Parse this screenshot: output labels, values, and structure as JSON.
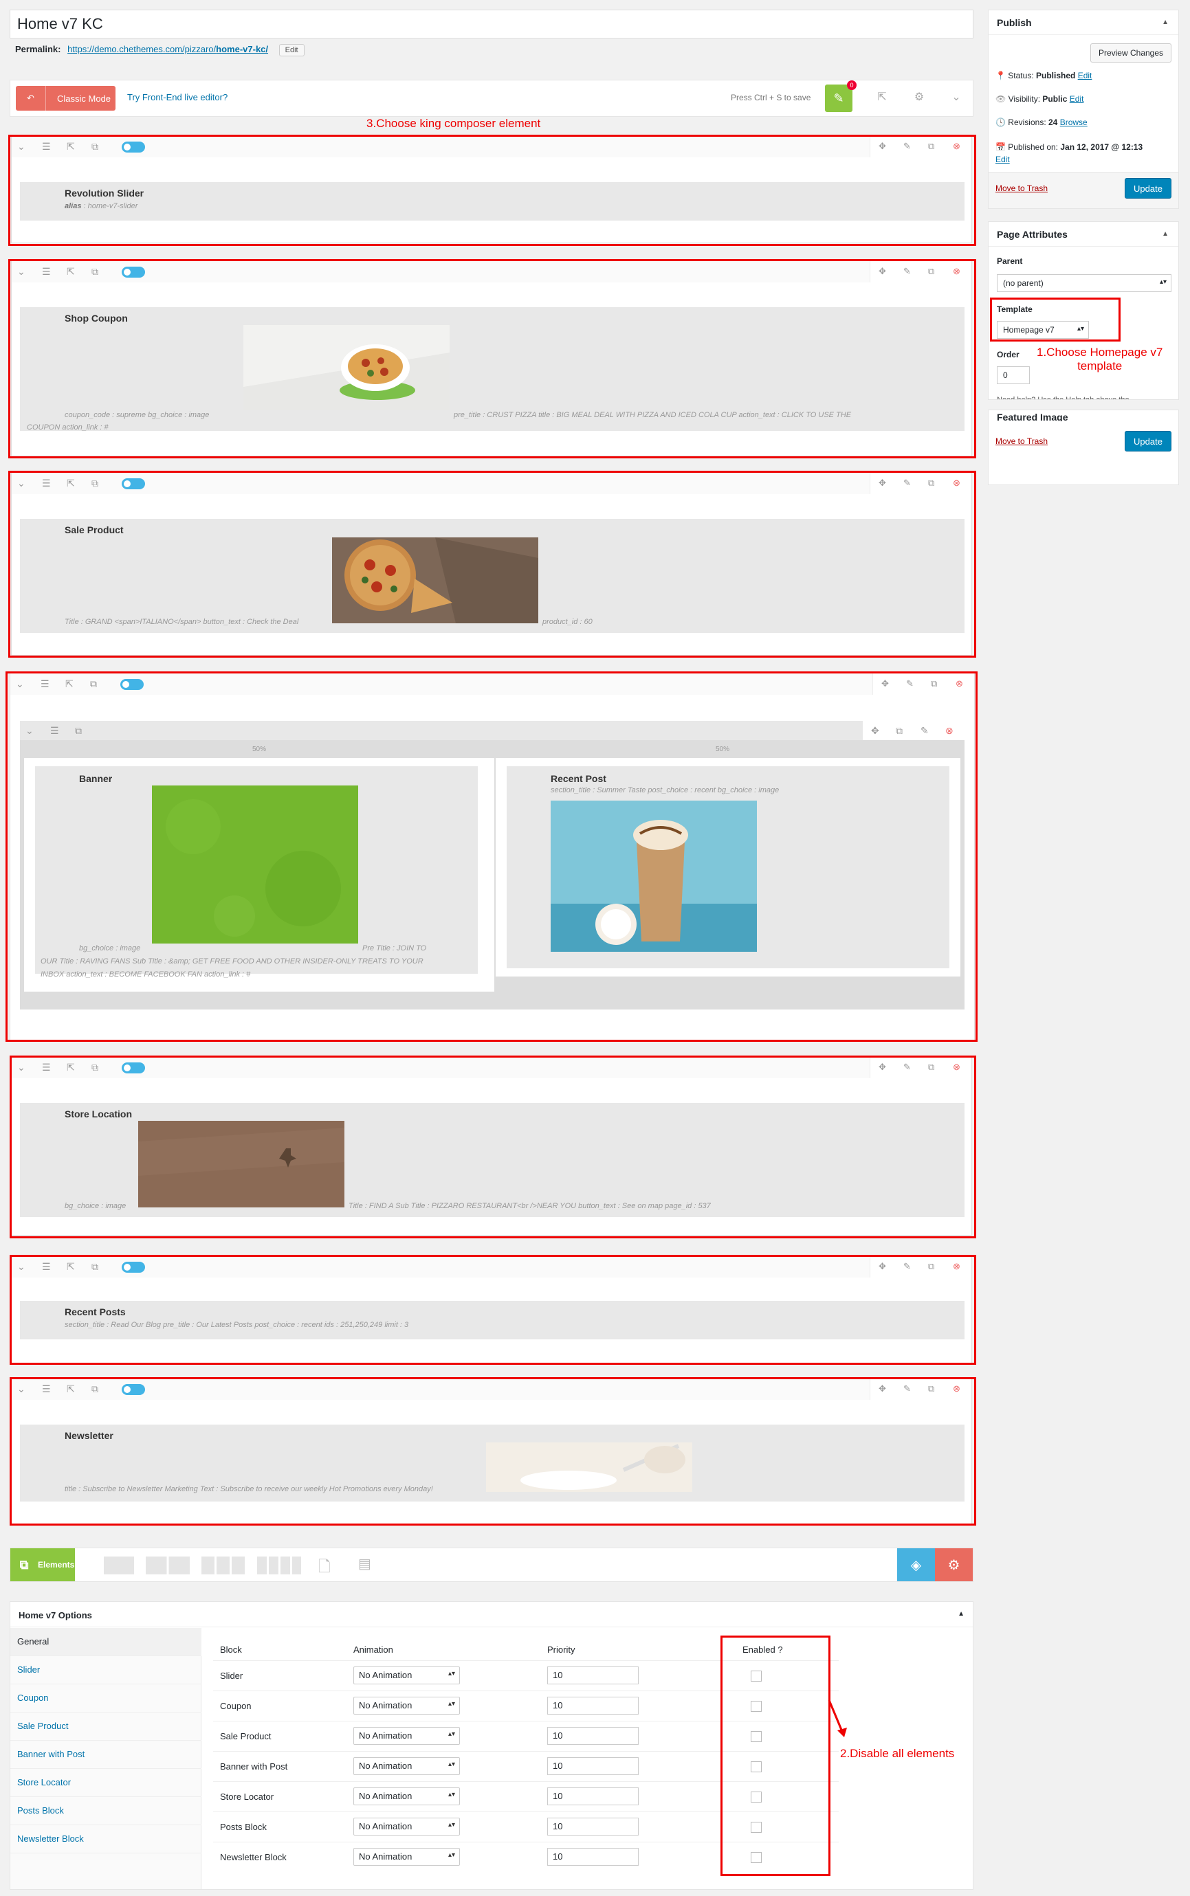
{
  "page": {
    "title": "Home v7 KC",
    "permalink_label": "Permalink:",
    "permalink_base": "https://demo.chethemes.com/pizzaro/",
    "permalink_slug": "home-v7-kc/",
    "edit_label": "Edit"
  },
  "editor": {
    "classic_mode": "Classic Mode",
    "frontend_link": "Try Front-End live editor?",
    "press_save": "Press Ctrl + S to save",
    "badge": "0"
  },
  "annotations": {
    "step1": "1.Choose Homepage v7 template",
    "step1_line1": "1.Choose Homepage v7",
    "step1_line2": "template",
    "step2": "2.Disable all elements",
    "step3": "3.Choose king composer element"
  },
  "elements": {
    "revolution": {
      "title": "Revolution Slider",
      "meta_key": "alias",
      "meta_val": "home-v7-slider"
    },
    "coupon": {
      "title": "Shop Coupon",
      "line1": "coupon_code : supreme bg_choice : image",
      "line2": "pre_title : CRUST PIZZA title : BIG MEAL DEAL WITH PIZZA AND ICED COLA CUP action_text : CLICK TO USE THE",
      "line3": "COUPON action_link : #"
    },
    "sale": {
      "title": "Sale Product",
      "line1": "Title : GRAND <span>ITALIANO</span> button_text : Check the Deal",
      "line2": "product_id : 60"
    },
    "columns": {
      "left_pct": "50%",
      "right_pct": "50%"
    },
    "banner": {
      "title": "Banner",
      "line1": "bg_choice : image",
      "line2": "Pre Title : JOIN TO",
      "line3": "OUR Title : RAVING FANS Sub Title : &amp; GET FREE FOOD AND OTHER INSIDER-ONLY TREATS TO YOUR",
      "line4": "INBOX action_text : BECOME FACEBOOK FAN action_link : #"
    },
    "recent_post": {
      "title": "Recent Post",
      "line1": "section_title : Summer Taste post_choice : recent bg_choice : image"
    },
    "store": {
      "title": "Store Location",
      "line1": "bg_choice : image",
      "line2": "Title : FIND A Sub Title : PIZZARO RESTAURANT<br />NEAR YOU button_text : See on map page_id : 537"
    },
    "recent_posts": {
      "title": "Recent Posts",
      "line1": "section_title : Read Our Blog pre_title : Our Latest Posts post_choice : recent ids : 251,250,249 limit : 3"
    },
    "newsletter": {
      "title": "Newsletter",
      "line1": "title : Subscribe to Newsletter Marketing Text : Subscribe to receive our weekly Hot Promotions every Monday!"
    }
  },
  "publish": {
    "header": "Publish",
    "preview": "Preview Changes",
    "status_label": "Status:",
    "status_val": "Published",
    "visibility_label": "Visibility:",
    "visibility_val": "Public",
    "revisions_label": "Revisions:",
    "revisions_val": "24",
    "browse": "Browse",
    "published_label": "Published on:",
    "published_val": "Jan 12, 2017 @ 12:13",
    "edit": "Edit",
    "trash": "Move to Trash",
    "update": "Update"
  },
  "attributes": {
    "header": "Page Attributes",
    "parent_label": "Parent",
    "parent_val": "(no parent)",
    "template_label": "Template",
    "template_val": "Homepage v7",
    "order_label": "Order",
    "order_val": "0",
    "help_text": "Need help? Use the Help tab above the"
  },
  "featured": {
    "header": "Featured Image",
    "trash": "Move to Trash",
    "update": "Update"
  },
  "elements_bar": {
    "label": "Elements"
  },
  "options": {
    "title": "Home v7 Options",
    "tabs": [
      "General",
      "Slider",
      "Coupon",
      "Sale Product",
      "Banner with Post",
      "Store Locator",
      "Posts Block",
      "Newsletter Block"
    ],
    "headers": [
      "Block",
      "Animation",
      "Priority",
      "Enabled ?"
    ],
    "rows": [
      {
        "block": "Slider",
        "animation": "No Animation",
        "priority": "10"
      },
      {
        "block": "Coupon",
        "animation": "No Animation",
        "priority": "10"
      },
      {
        "block": "Sale Product",
        "animation": "No Animation",
        "priority": "10"
      },
      {
        "block": "Banner with Post",
        "animation": "No Animation",
        "priority": "10"
      },
      {
        "block": "Store Locator",
        "animation": "No Animation",
        "priority": "10"
      },
      {
        "block": "Posts Block",
        "animation": "No Animation",
        "priority": "10"
      },
      {
        "block": "Newsletter Block",
        "animation": "No Animation",
        "priority": "10"
      }
    ]
  }
}
